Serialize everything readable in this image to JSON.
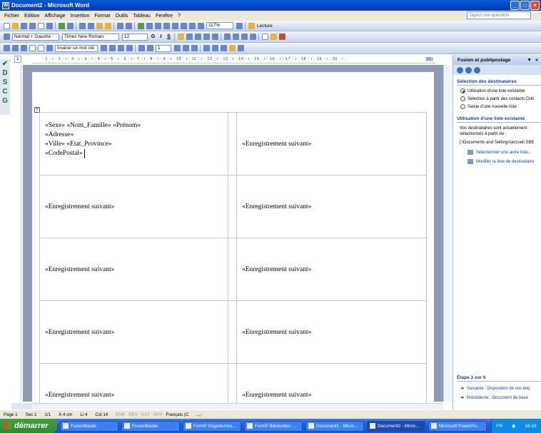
{
  "window": {
    "title": "Document2 - Microsoft Word"
  },
  "menu": {
    "items": [
      "Fichier",
      "Edition",
      "Affichage",
      "Insertion",
      "Format",
      "Outils",
      "Tableau",
      "Fenêtre",
      "?"
    ],
    "ask_placeholder": "Tapez une question"
  },
  "toolbar_standard": {
    "zoom": "117%",
    "reading": "Lecture"
  },
  "toolbar_format": {
    "style": "Normal + Gauche :",
    "font": "Times New Roman",
    "size": "12",
    "bold": "G",
    "italic": "I",
    "underline": "S"
  },
  "toolbar_merge": {
    "insert_field": "Insérer un mot clé",
    "record": "1"
  },
  "left_toolbar": {
    "letters": [
      "D",
      "S",
      "C",
      "G"
    ]
  },
  "ruler": {
    "end_mark": "21"
  },
  "document": {
    "first_label_lines": [
      "«Sexe» «Nom_Famille» «Prénom»",
      "«Adresse»",
      "«Ville» «Etat_Province»",
      "«CodePostal»"
    ],
    "next_record": "«Enregistrement suivant»",
    "rows": 5
  },
  "taskpane": {
    "title": "Fusion et publipostage",
    "section1": "Sélection des destinataires",
    "radio1": "Utilisation d'une liste existante",
    "radio2": "Sélection à partir des contacts Outl",
    "radio3": "Saisie d'une nouvelle liste",
    "section2": "Utilisation d'une liste existante",
    "desc": "Vos destinataires sont actuellement sélectionnés à partir de :",
    "path": "[:\\Documents and Settings\\accueil.SBE",
    "link1": "Sélectionner une autre liste...",
    "link2": "Modifier la liste de destinataire",
    "step": "Étape 3 sur 6",
    "next": "Suivante : Disposition de vos étiq",
    "prev": "Précédente : Document de base"
  },
  "status": {
    "page": "Page 1",
    "section": "Sec 1",
    "pages": "1/1",
    "at": "À 4 cm",
    "line": "Li 4",
    "col": "Col 14",
    "enr": "ENR",
    "rev": "REV",
    "ext": "EXT",
    "rfp": "RFP",
    "lang": "Français (C"
  },
  "taskbar": {
    "start": "démarrer",
    "tasks": [
      "FusionBasile",
      "FusionBasile",
      "FormP Organismes...",
      "FormP Bénévoles :...",
      "Document1 - Micro...",
      "Document2 - Micro...",
      "Microsoft PowerPo..."
    ],
    "lang": "FR",
    "time": "16:33"
  }
}
